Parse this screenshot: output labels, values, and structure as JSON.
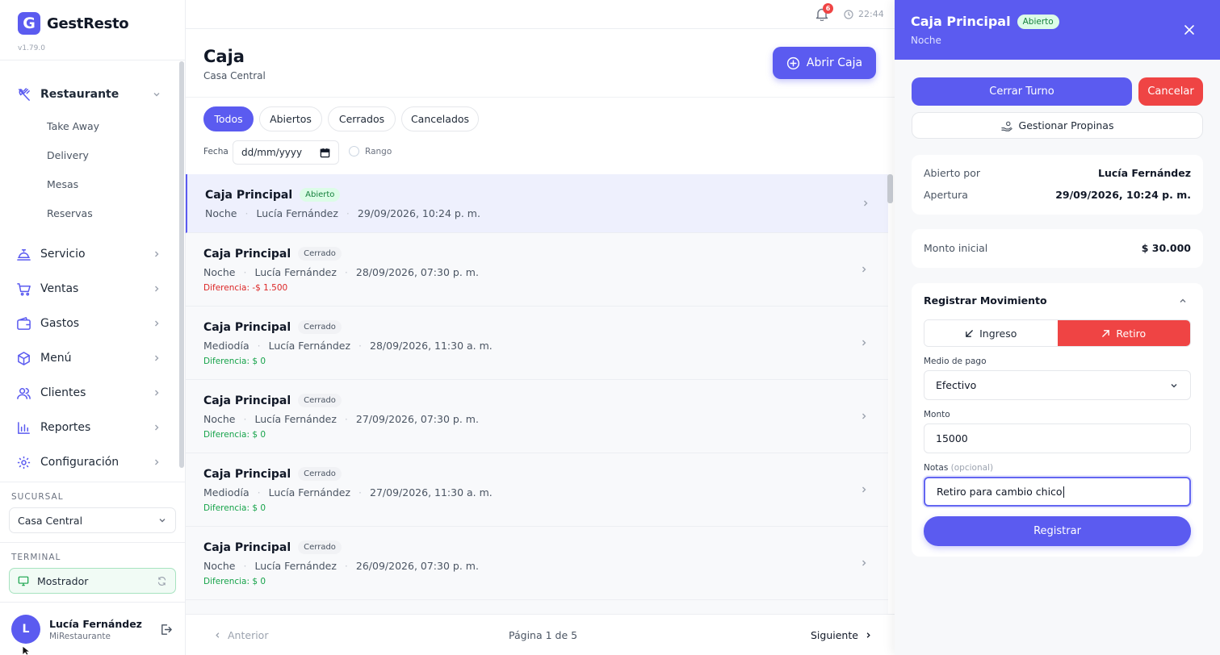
{
  "app": {
    "name": "GestResto",
    "logo_letter": "G",
    "version": "v1.79.0",
    "brand_color": "#5b5bf0"
  },
  "sidebar": {
    "restaurant": {
      "label": "Restaurante",
      "sub": [
        "Take Away",
        "Delivery",
        "Mesas",
        "Reservas"
      ]
    },
    "items": [
      {
        "label": "Servicio",
        "icon": "service-icon"
      },
      {
        "label": "Ventas",
        "icon": "cart-icon"
      },
      {
        "label": "Gastos",
        "icon": "wallet-icon"
      },
      {
        "label": "Menú",
        "icon": "box-icon"
      },
      {
        "label": "Clientes",
        "icon": "users-icon"
      },
      {
        "label": "Reportes",
        "icon": "chart-icon"
      },
      {
        "label": "Configuración",
        "icon": "gear-icon"
      }
    ],
    "sucursal": {
      "label": "SUCURSAL",
      "value": "Casa Central"
    },
    "terminal": {
      "label": "TERMINAL",
      "value": "Mostrador"
    },
    "user": {
      "initial": "L",
      "name": "Lucía Fernández",
      "org": "MiRestaurante"
    }
  },
  "topbar": {
    "notifications": "6",
    "time": "22:44"
  },
  "main": {
    "title": "Caja",
    "subtitle": "Casa Central",
    "open_button": "Abrir Caja",
    "filters": [
      "Todos",
      "Abiertos",
      "Cerrados",
      "Cancelados"
    ],
    "date_label": "Fecha",
    "date_placeholder": "dd/mm/yyyy",
    "range_label": "Rango",
    "rows": [
      {
        "title": "Caja Principal",
        "status": "Abierto",
        "shift": "Noche",
        "user": "Lucía Fernández",
        "date": "29/09/2026, 10:24 p. m.",
        "diff": ""
      },
      {
        "title": "Caja Principal",
        "status": "Cerrado",
        "shift": "Noche",
        "user": "Lucía Fernández",
        "date": "28/09/2026, 07:30 p. m.",
        "diff": "Diferencia: -$ 1.500"
      },
      {
        "title": "Caja Principal",
        "status": "Cerrado",
        "shift": "Mediodía",
        "user": "Lucía Fernández",
        "date": "28/09/2026, 11:30 a. m.",
        "diff": "Diferencia: $ 0"
      },
      {
        "title": "Caja Principal",
        "status": "Cerrado",
        "shift": "Noche",
        "user": "Lucía Fernández",
        "date": "27/09/2026, 07:30 p. m.",
        "diff": "Diferencia: $ 0"
      },
      {
        "title": "Caja Principal",
        "status": "Cerrado",
        "shift": "Mediodía",
        "user": "Lucía Fernández",
        "date": "27/09/2026, 11:30 a. m.",
        "diff": "Diferencia: $ 0"
      },
      {
        "title": "Caja Principal",
        "status": "Cerrado",
        "shift": "Noche",
        "user": "Lucía Fernández",
        "date": "26/09/2026, 07:30 p. m.",
        "diff": "Diferencia: $ 0"
      }
    ],
    "pager": {
      "prev": "Anterior",
      "page": "Página 1 de 5",
      "next": "Siguiente"
    }
  },
  "panel": {
    "title": "Caja Principal",
    "status": "Abierto",
    "subtitle": "Noche",
    "close_shift": "Cerrar Turno",
    "cancel": "Cancelar",
    "tips": "Gestionar Propinas",
    "opened_by_label": "Abierto por",
    "opened_by": "Lucía Fernández",
    "opening_label": "Apertura",
    "opening": "29/09/2026, 10:24 p. m.",
    "initial_label": "Monto inicial",
    "initial": "$ 30.000",
    "movement": {
      "title": "Registrar Movimiento",
      "ingreso": "Ingreso",
      "retiro": "Retiro",
      "payment_label": "Medio de pago",
      "payment": "Efectivo",
      "amount_label": "Monto",
      "amount": "15000",
      "notes_label": "Notas",
      "notes_optional": "(opcional)",
      "notes": "Retiro para cambio chico",
      "register": "Registrar"
    }
  }
}
